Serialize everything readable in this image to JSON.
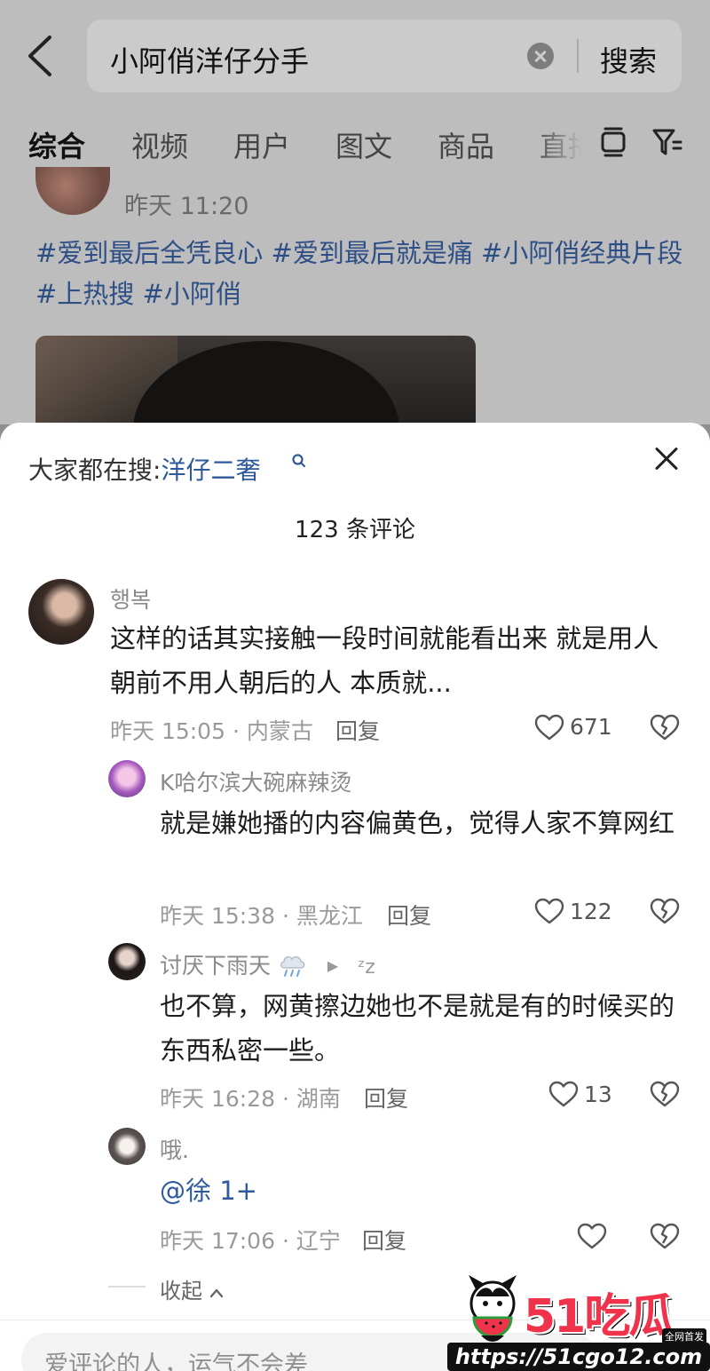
{
  "search": {
    "query": "小阿俏洋仔分手",
    "button_label": "搜索"
  },
  "tabs": [
    {
      "label": "综合",
      "active": true
    },
    {
      "label": "视频"
    },
    {
      "label": "用户"
    },
    {
      "label": "图文"
    },
    {
      "label": "商品"
    },
    {
      "label": "直播"
    }
  ],
  "post": {
    "time": "昨天 11:20",
    "text": "#爱到最后全凭良心 #爱到最后就是痛 #小阿俏经典片段  #上热搜 #小阿俏"
  },
  "sheet": {
    "hot_search_label": "大家都在搜:",
    "hot_search_term": "洋仔二奢",
    "comment_count": "123 条评论",
    "collapse_label": "收起",
    "input_placeholder": "爱评论的人，运气不会差"
  },
  "comments": [
    {
      "name": "행복",
      "text": "这样的话其实接触一段时间就能看出来 就是用人朝前不用人朝后的人 本质就...",
      "meta": "昨天 15:05 · 内蒙古",
      "reply_label": "回复",
      "likes": "671"
    },
    {
      "name": "K哈尔滨大碗麻辣烫",
      "text": "就是嫌她播的内容偏黄色，觉得人家不算网红",
      "meta": "昨天 15:38 · 黑龙江",
      "reply_label": "回复",
      "likes": "122"
    },
    {
      "name": "讨厌下雨天",
      "name_suffix": "ᶻz",
      "text": "也不算，网黄擦边她也不是就是有的时候买的东西私密一些。",
      "meta": "昨天 16:28 · 湖南",
      "reply_label": "回复",
      "likes": "13"
    },
    {
      "name": "哦.",
      "text": "@徐 1+",
      "meta": "昨天 17:06 · 辽宁",
      "reply_label": "回复",
      "likes": ""
    }
  ],
  "watermark": {
    "logo": "51吃瓜",
    "tag": "全网首发",
    "url": "https://51cgo12.com"
  },
  "colors": {
    "link": "#2e5a9c",
    "dim_overlay": "#bdbdbd",
    "watermark_red": "#f0334b"
  }
}
